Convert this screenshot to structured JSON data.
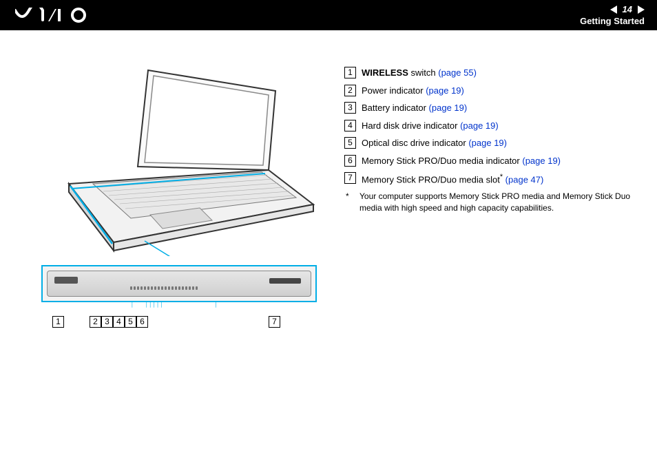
{
  "header": {
    "page_number": "14",
    "section": "Getting Started"
  },
  "illustration": {
    "callouts": [
      "1",
      "2",
      "3",
      "4",
      "5",
      "6",
      "7"
    ]
  },
  "legend": [
    {
      "num": "1",
      "bold": "WIRELESS",
      "text": " switch ",
      "ref": "(page 55)"
    },
    {
      "num": "2",
      "bold": "",
      "text": "Power indicator ",
      "ref": "(page 19)"
    },
    {
      "num": "3",
      "bold": "",
      "text": "Battery indicator ",
      "ref": "(page 19)"
    },
    {
      "num": "4",
      "bold": "",
      "text": "Hard disk drive indicator ",
      "ref": "(page 19)"
    },
    {
      "num": "5",
      "bold": "",
      "text": "Optical disc drive indicator ",
      "ref": "(page 19)"
    },
    {
      "num": "6",
      "bold": "",
      "text": "Memory Stick PRO/Duo media indicator ",
      "ref": "(page 19)"
    },
    {
      "num": "7",
      "bold": "",
      "text": "Memory Stick PRO/Duo media slot",
      "sup": "*",
      "ref": " (page 47)"
    }
  ],
  "footnote": {
    "mark": "*",
    "text": "Your computer supports Memory Stick PRO media and Memory Stick Duo media with high speed and high capacity capabilities."
  }
}
